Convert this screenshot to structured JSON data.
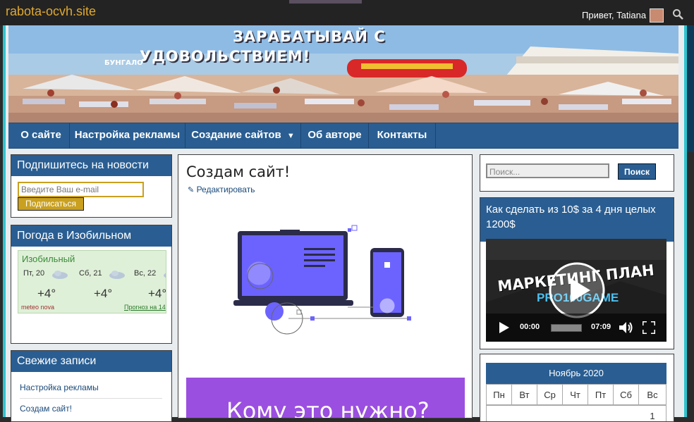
{
  "topbar": {
    "site_title": "rabota-ocvh.site",
    "greeting": "Привет, Tatiana"
  },
  "banner": {
    "line1": "ЗАРАБАТЫВАЙ С",
    "line2": "УДОВОЛЬСТВИЕМ!",
    "sign": "БУНГАЛО"
  },
  "nav": {
    "items": [
      "О сайте",
      "Настройка рекламы",
      "Создание сайтов",
      "Об авторе",
      "Контакты"
    ]
  },
  "subscribe": {
    "title": "Подпишитесь на новости",
    "placeholder": "Введите Ваш e-mail",
    "button": "Подписаться"
  },
  "weather": {
    "title": "Погода в Изобильном",
    "city": "Изобильный",
    "days": [
      {
        "day": "Пт, 20",
        "temp": "+4°"
      },
      {
        "day": "Сб, 21",
        "temp": "+4°"
      },
      {
        "day": "Вс, 22",
        "temp": "+4°"
      }
    ],
    "brand": "meteo nova",
    "forecast_link": "Прогноз на 14"
  },
  "recent": {
    "title": "Свежие записи",
    "items": [
      "Настройка рекламы",
      "Создам сайт!"
    ]
  },
  "post": {
    "title": "Создам сайт!",
    "edit": "Редактировать",
    "cta": "Кому это нужно?"
  },
  "search": {
    "placeholder": "Поиск...",
    "button": "Поиск"
  },
  "video_widget": {
    "title": "Как сделать из 10$ за 4 дня целых 1200$",
    "overlay_line1": "МАРКЕТИНГ ПЛАН",
    "overlay_line2": "PRO100GAME",
    "time_current": "00:00",
    "time_total": "07:09"
  },
  "calendar": {
    "month": "Ноябрь 2020",
    "weekdays": [
      "Пн",
      "Вт",
      "Ср",
      "Чт",
      "Пт",
      "Сб",
      "Вс"
    ],
    "first_day": "1"
  },
  "colors": {
    "accent": "#2a5e92",
    "frame": "#2fc4cf",
    "title": "#e0a830",
    "cta": "#9b4fe0"
  }
}
